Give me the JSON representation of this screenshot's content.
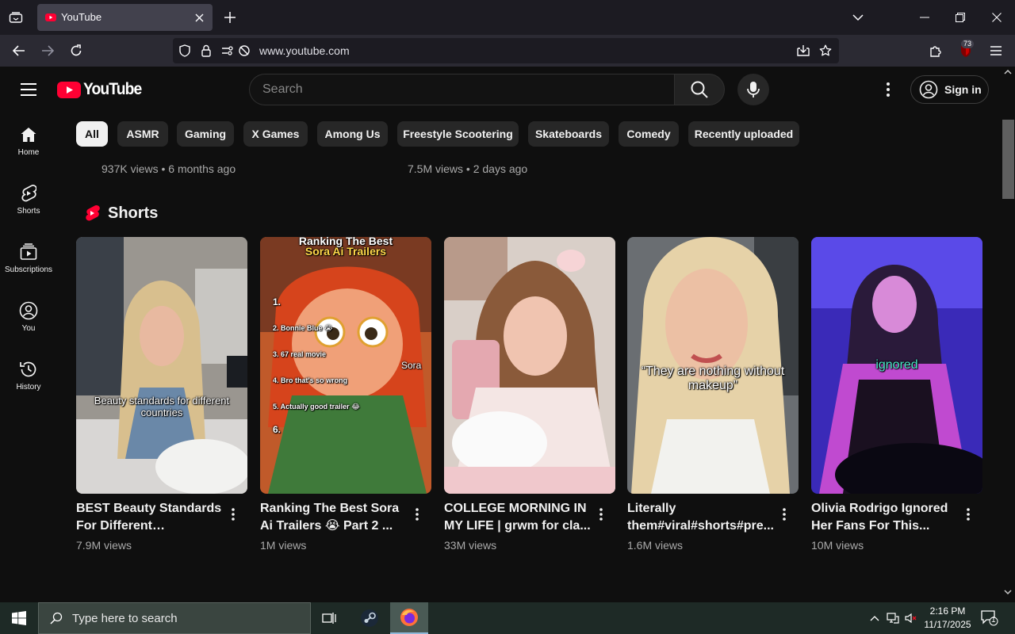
{
  "browser": {
    "tab_title": "YouTube",
    "url": "www.youtube.com",
    "extension_badge": "73"
  },
  "masthead": {
    "logo_text": "YouTube",
    "search_placeholder": "Search",
    "signin_label": "Sign in"
  },
  "guide": {
    "items": [
      {
        "label": "Home",
        "icon": "home-icon"
      },
      {
        "label": "Shorts",
        "icon": "shorts-icon"
      },
      {
        "label": "Subscriptions",
        "icon": "subscriptions-icon"
      },
      {
        "label": "You",
        "icon": "you-icon"
      },
      {
        "label": "History",
        "icon": "history-icon"
      }
    ]
  },
  "chips": [
    "All",
    "ASMR",
    "Gaming",
    "X Games",
    "Among Us",
    "Freestyle Scootering",
    "Skateboards",
    "Comedy",
    "Recently uploaded"
  ],
  "previous_row": [
    {
      "meta": "937K views • 6 months ago"
    },
    {
      "meta": "7.5M views • 2 days ago"
    }
  ],
  "shorts": {
    "section_title": "Shorts",
    "items": [
      {
        "title": "BEST Beauty Standards For Different Countries!...",
        "views": "7.9M views",
        "overlay": "Beauty standards for different countries"
      },
      {
        "title": "Ranking The Best Sora Ai Trailers 😭 Part 2 ...",
        "views": "1M views",
        "overlay_top": "Ranking The Best",
        "overlay_sub": "Sora Ai Trailers",
        "list": [
          "1.",
          "2. Bonnie Blue 😭",
          "3. 67 real movie",
          "4. Bro that's so wrong",
          "5. Actually good trailer 😂",
          "6."
        ],
        "watermark": "Sora"
      },
      {
        "title": "COLLEGE MORNING IN MY LIFE | grwm for cla...",
        "views": "33M views"
      },
      {
        "title": "Literally them#viral#shorts#pre...",
        "views": "1.6M views",
        "overlay": "“They are nothing without makeup”"
      },
      {
        "title": "Olivia Rodrigo Ignored Her Fans For This...",
        "views": "10M views",
        "overlay": "ignored"
      }
    ]
  },
  "taskbar": {
    "search_placeholder": "Type here to search",
    "time": "2:16 PM",
    "date": "11/17/2025",
    "notification_count": "1"
  },
  "colors": {
    "yt_red": "#ff0033",
    "background": "#0f0f0f",
    "chip_bg": "#272727",
    "chip_active_bg": "#f1f1f1"
  }
}
